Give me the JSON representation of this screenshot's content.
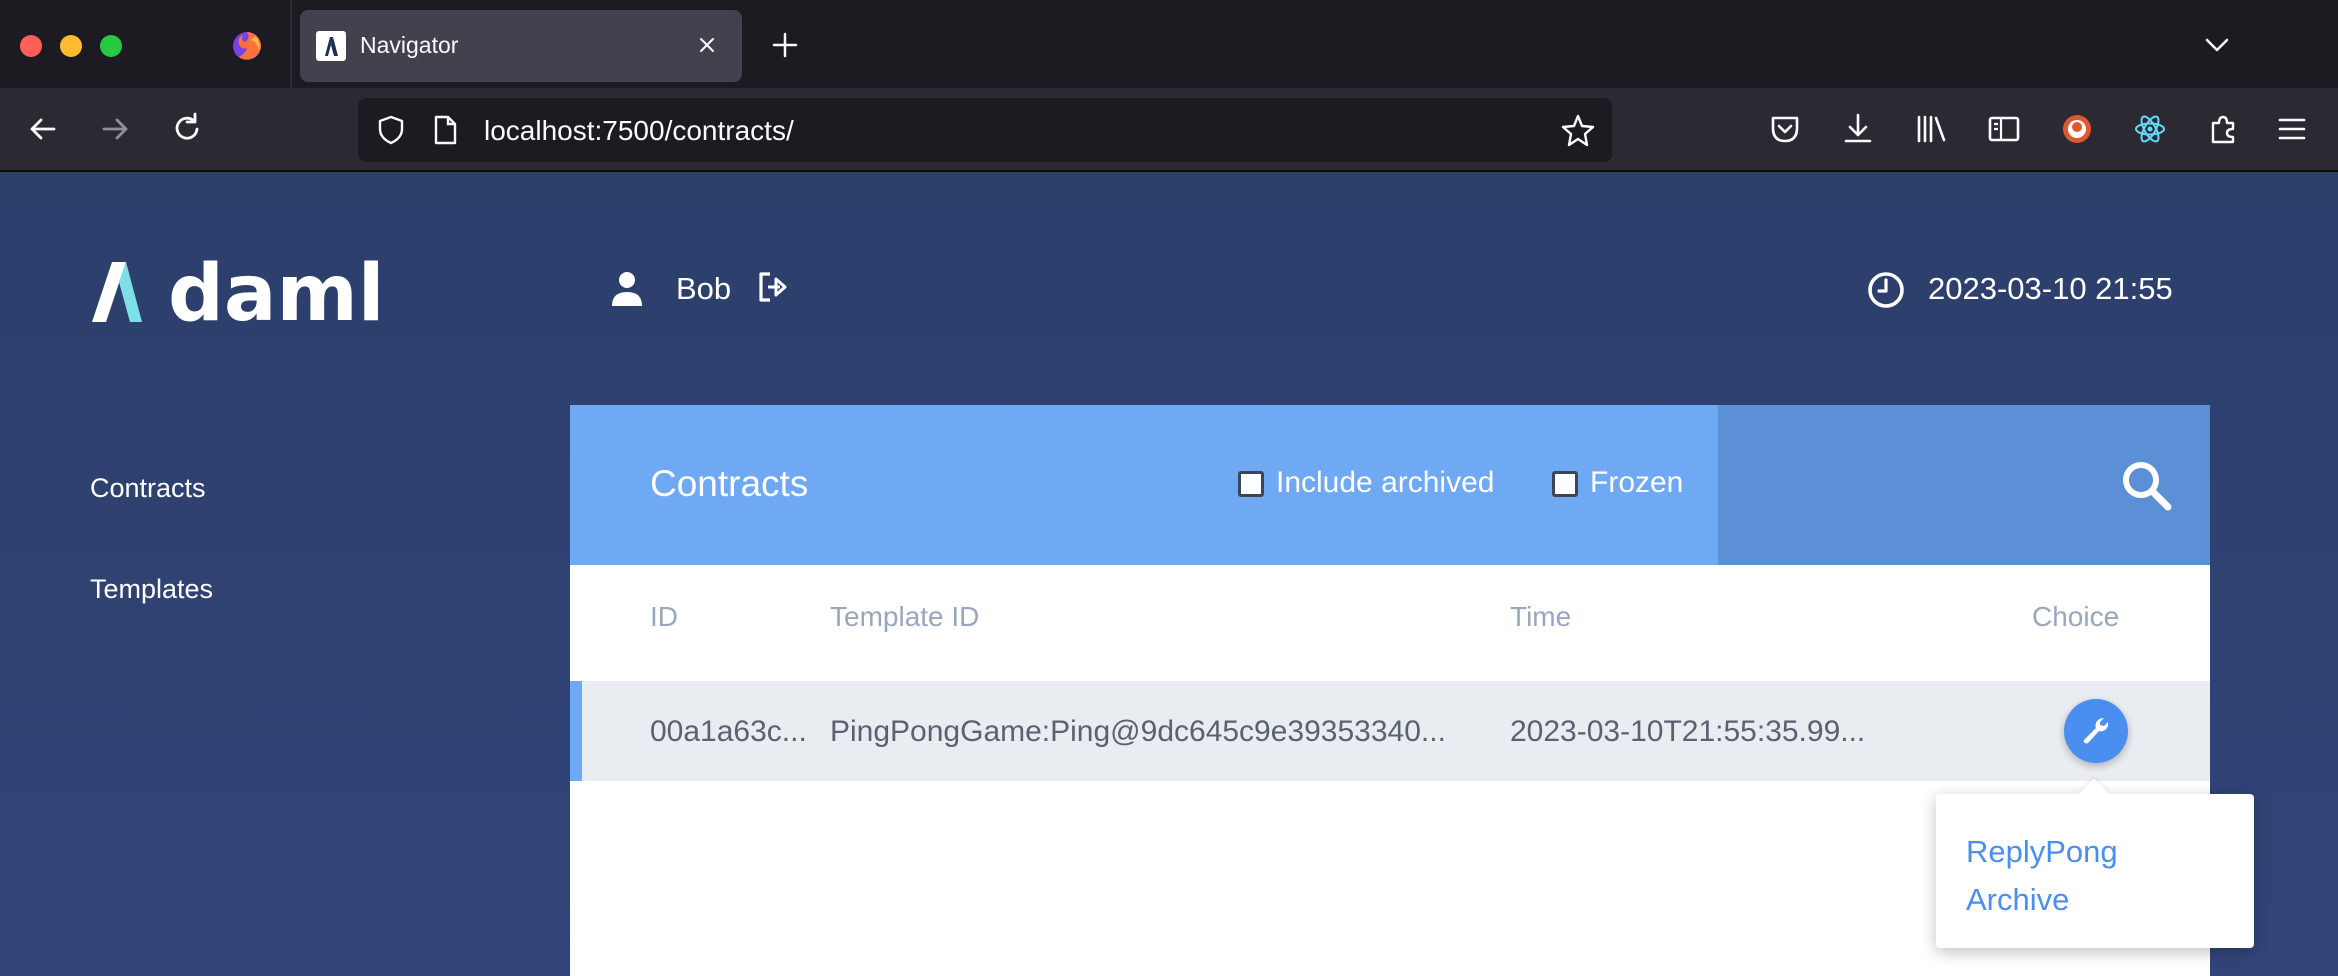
{
  "browser": {
    "tab_title": "Navigator",
    "url": "localhost:7500/contracts/"
  },
  "header": {
    "logo_text": "daml",
    "user_name": "Bob",
    "timestamp": "2023-03-10 21:55"
  },
  "sidebar": {
    "items": [
      {
        "label": "Contracts"
      },
      {
        "label": "Templates"
      }
    ]
  },
  "contracts": {
    "title": "Contracts",
    "include_archived_label": "Include archived",
    "frozen_label": "Frozen",
    "columns": [
      "ID",
      "Template ID",
      "Time",
      "Choice"
    ],
    "rows": [
      {
        "id": "00a1a63c...",
        "template_id": "PingPongGame:Ping@9dc645c9e39353340...",
        "time": "2023-03-10T21:55:35.99..."
      }
    ]
  },
  "choice_menu": {
    "items": [
      "ReplyPong",
      "Archive"
    ]
  },
  "colors": {
    "page_bg": "#2c3e6a",
    "panel_header": "#6fa9f3",
    "search_area": "#5b90d7",
    "accent": "#4a8ef0"
  }
}
